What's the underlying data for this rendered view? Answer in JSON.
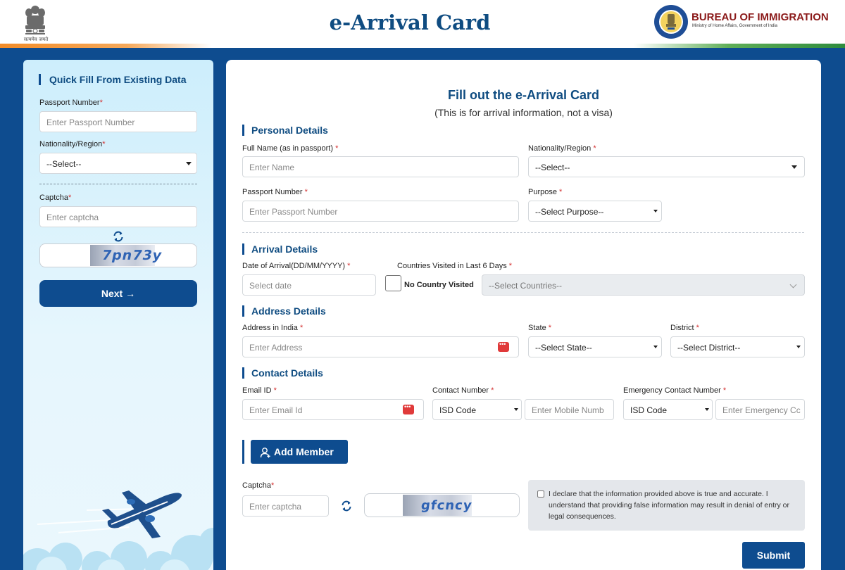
{
  "header": {
    "site_title": "e-Arrival Card",
    "emblem_motto": "सत्यमेव जयते",
    "bureau_title": "BUREAU OF IMMIGRATION",
    "bureau_subtitle": "Ministry of Home Affairs, Government of India",
    "bureau_seal_text": "BUREAU OF IMMIGRATION · MINISTRY OF HOME AFFAIRS · INDIA"
  },
  "quick_fill": {
    "heading": "Quick Fill From Existing Data",
    "passport_label": "Passport Number",
    "passport_placeholder": "Enter Passport Number",
    "nationality_label": "Nationality/Region",
    "nationality_value": "--Select--",
    "captcha_label": "Captcha",
    "captcha_placeholder": "Enter captcha",
    "captcha_text": "7pn73y",
    "next_label": "Next →"
  },
  "form": {
    "title": "Fill out the e-Arrival Card",
    "subtitle": "(This is for arrival information, not a visa)",
    "required_mark": "*",
    "personal": {
      "heading": "Personal Details",
      "full_name_label": "Full Name (as in passport)",
      "full_name_placeholder": "Enter Name",
      "nationality_label": "Nationality/Region",
      "nationality_value": "--Select--",
      "passport_label": "Passport Number",
      "passport_placeholder": "Enter Passport Number",
      "purpose_label": "Purpose",
      "purpose_value": "--Select Purpose--"
    },
    "arrival": {
      "heading": "Arrival Details",
      "date_label": "Date of Arrival(DD/MM/YYYY)",
      "date_placeholder": "Select date",
      "countries_label": "Countries Visited in Last 6 Days",
      "no_country_label": "No Country Visited",
      "countries_value": "--Select Countries--"
    },
    "address": {
      "heading": "Address Details",
      "address_label": "Address in India",
      "address_placeholder": "Enter Address",
      "state_label": "State",
      "state_value": "--Select State--",
      "district_label": "District",
      "district_value": "--Select District--"
    },
    "contact": {
      "heading": "Contact Details",
      "email_label": "Email ID",
      "email_placeholder": "Enter Email Id",
      "contact_label": "Contact Number",
      "isd_value": "ISD Code",
      "mobile_placeholder": "Enter Mobile Numb",
      "emergency_label": "Emergency Contact Number",
      "emergency_isd_value": "ISD Code",
      "emergency_placeholder": "Enter Emergency Cc"
    },
    "add_member_label": "Add Member",
    "captcha_label": "Captcha",
    "captcha_placeholder": "Enter captcha",
    "captcha_text": "gfcncy",
    "declaration": "I declare that the information provided above is true and accurate. I understand that providing false information may result in denial of entry or legal consequences.",
    "submit_label": "Submit"
  },
  "colors": {
    "primary": "#0e4c8f",
    "title_blue": "#0f4c81",
    "bureau_red": "#8b1a1a",
    "required_red": "#d32f2f",
    "saffron": "#f28c28",
    "green": "#2e8b3d"
  }
}
